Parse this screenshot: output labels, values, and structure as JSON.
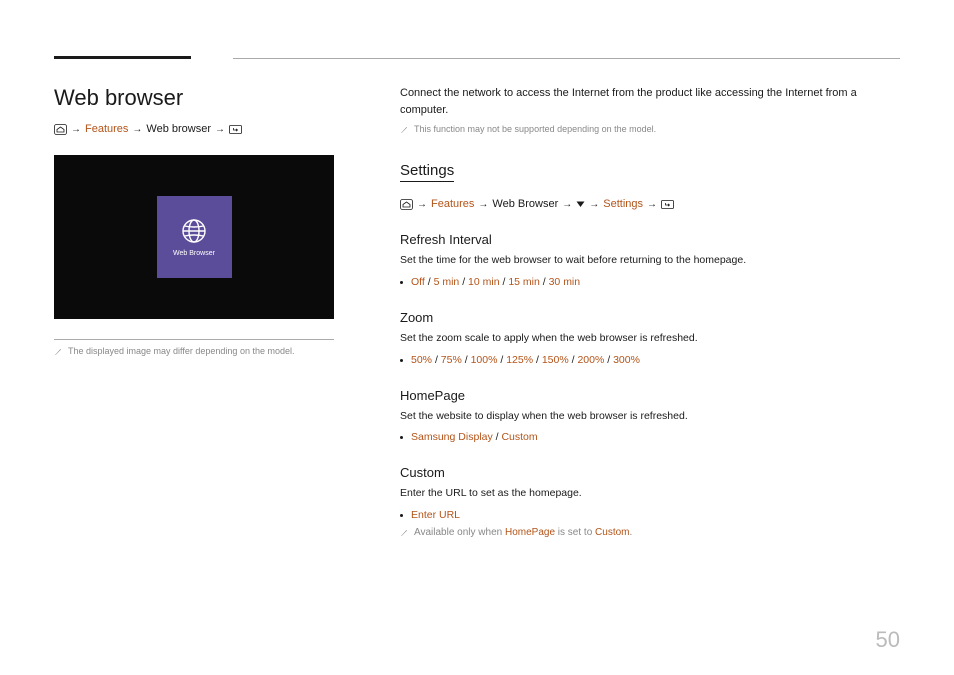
{
  "left": {
    "title": "Web browser",
    "breadcrumb": {
      "features": "Features",
      "webBrowser": "Web browser"
    },
    "tile": {
      "label": "Web Browser"
    },
    "imageNote": "The displayed image may differ depending on the model."
  },
  "right": {
    "intro": "Connect the network to access the Internet from the product like accessing the Internet from a computer.",
    "introNote": "This function may not be supported depending on the model.",
    "settingsTitle": "Settings",
    "breadcrumb2": {
      "features": "Features",
      "webBrowser": "Web Browser",
      "settings": "Settings"
    },
    "refresh": {
      "title": "Refresh Interval",
      "desc": "Set the time for the web browser to wait before returning to the homepage.",
      "options": [
        "Off",
        "5 min",
        "10 min",
        "15 min",
        "30 min"
      ]
    },
    "zoom": {
      "title": "Zoom",
      "desc": "Set the zoom scale to apply when the web browser is refreshed.",
      "options": [
        "50%",
        "75%",
        "100%",
        "125%",
        "150%",
        "200%",
        "300%"
      ]
    },
    "homepage": {
      "title": "HomePage",
      "desc": "Set the website to display when the web browser is refreshed.",
      "options": [
        "Samsung Display",
        "Custom"
      ]
    },
    "custom": {
      "title": "Custom",
      "desc": "Enter the URL to set as the homepage.",
      "options": [
        "Enter URL"
      ],
      "noteParts": {
        "p1": "Available only when ",
        "p2": "HomePage",
        "p3": " is set to ",
        "p4": "Custom",
        "p5": "."
      }
    }
  },
  "pageNumber": "50"
}
